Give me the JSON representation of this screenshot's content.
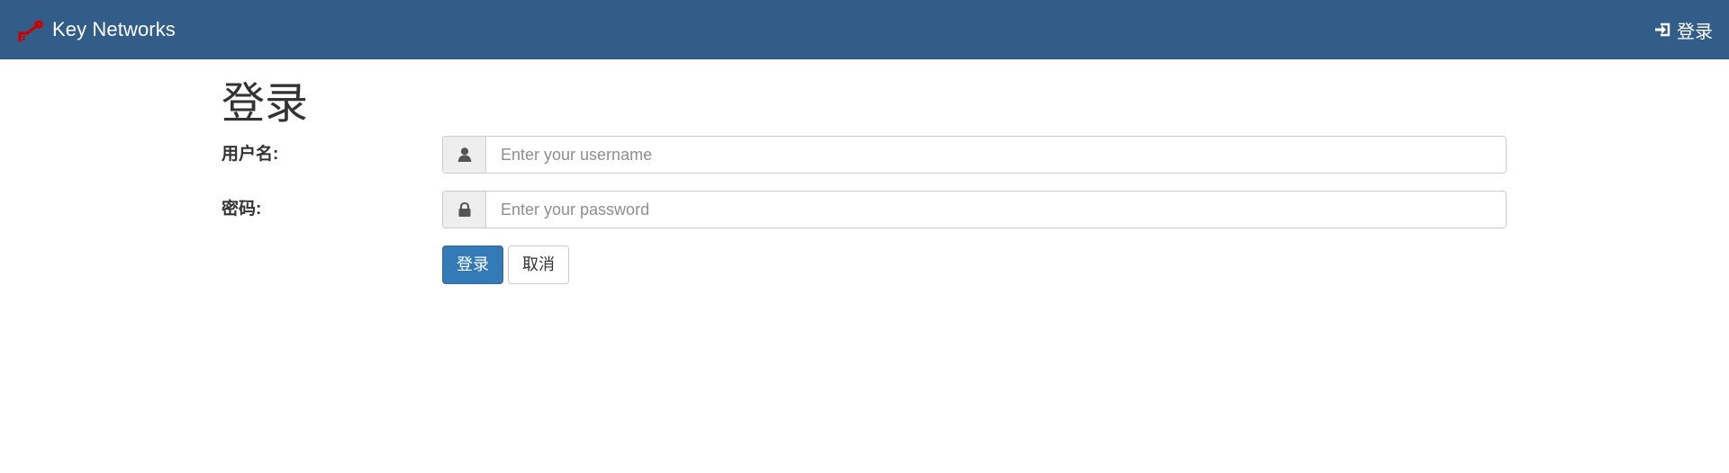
{
  "navbar": {
    "brand_name": "Key Networks",
    "brand_icon": "key-icon",
    "login_label": "登录",
    "login_icon": "sign-in-icon",
    "background_color": "#325d88",
    "brand_icon_color": "#cc0000"
  },
  "page": {
    "title": "登录"
  },
  "form": {
    "username": {
      "label": "用户名:",
      "placeholder": "Enter your username",
      "value": "",
      "icon": "user-icon"
    },
    "password": {
      "label": "密码:",
      "placeholder": "Enter your password",
      "value": "",
      "icon": "lock-icon"
    },
    "submit_label": "登录",
    "cancel_label": "取消",
    "primary_color": "#337ab7"
  }
}
